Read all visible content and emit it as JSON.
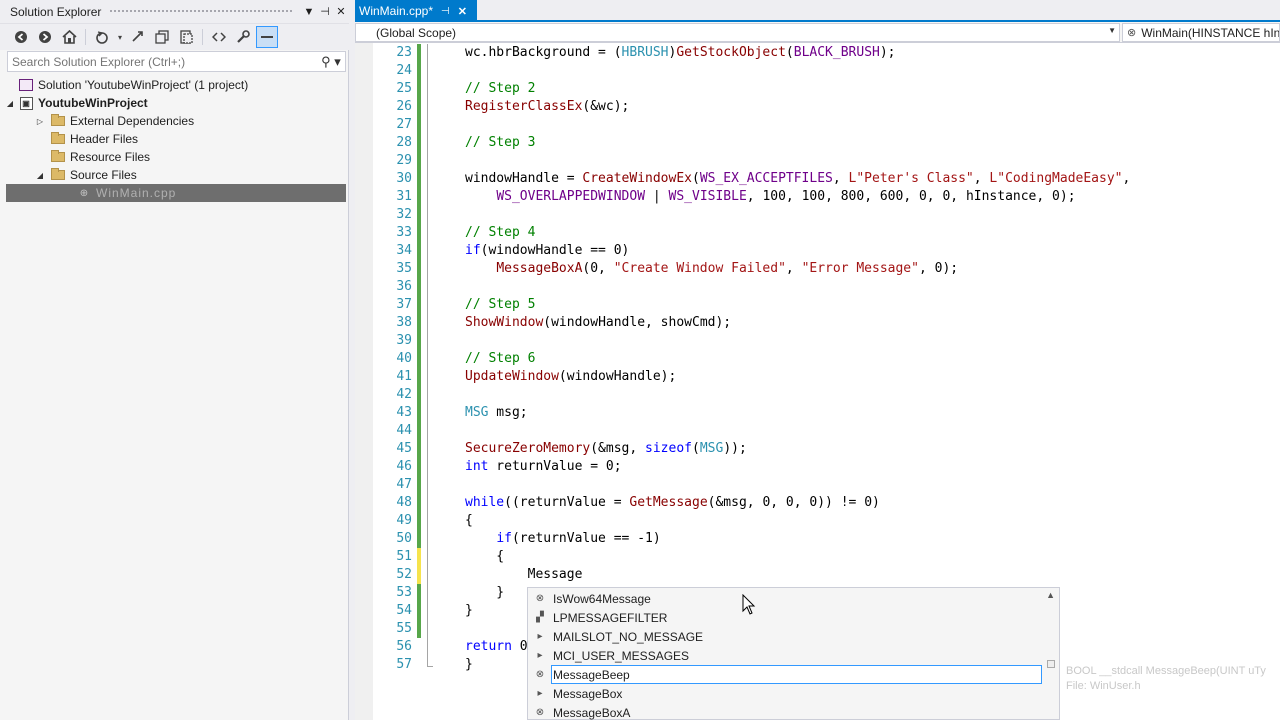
{
  "solution_explorer": {
    "title": "Solution Explorer",
    "title_buttons": [
      "▼",
      "📌",
      "✕"
    ],
    "search_placeholder": "Search Solution Explorer (Ctrl+;)",
    "tree": [
      {
        "label": "Solution 'YoutubeWinProject' (1 project)",
        "icon": "solution-icon",
        "level": 0
      },
      {
        "label": "YoutubeWinProject",
        "icon": "project-icon",
        "level": 0,
        "expanded": true
      },
      {
        "label": "External Dependencies",
        "icon": "external-deps-icon",
        "level": 1,
        "collapsed": true
      },
      {
        "label": "Header Files",
        "icon": "folder-icon",
        "level": 1
      },
      {
        "label": "Resource Files",
        "icon": "folder-icon",
        "level": 1
      },
      {
        "label": "Source Files",
        "icon": "folder-icon",
        "level": 1,
        "expanded": true
      },
      {
        "label": "WinMain.cpp",
        "icon": "cpp-file-icon",
        "level": 2,
        "selected": true
      }
    ]
  },
  "editor": {
    "tab_label": "WinMain.cpp*",
    "tab_pin": "⊣",
    "tab_close": "✕",
    "scope": "(Global Scope)",
    "function": "WinMain(HINSTANCE hInstance,",
    "current_line": "52",
    "lines": [
      {
        "n": "23",
        "code": "wc.hbrBackground = (HBRUSH)GetStockObject(BLACK_BRUSH);"
      },
      {
        "n": "24",
        "code": ""
      },
      {
        "n": "25",
        "code": "// Step 2"
      },
      {
        "n": "26",
        "code": "RegisterClassEx(&wc);"
      },
      {
        "n": "27",
        "code": ""
      },
      {
        "n": "28",
        "code": "// Step 3"
      },
      {
        "n": "29",
        "code": ""
      },
      {
        "n": "30",
        "code": "windowHandle = CreateWindowEx(WS_EX_ACCEPTFILES, L\"Peter's Class\", L\"CodingMadeEasy\","
      },
      {
        "n": "31",
        "code": "    WS_OVERLAPPEDWINDOW | WS_VISIBLE, 100, 100, 800, 600, 0, 0, hInstance, 0);"
      },
      {
        "n": "32",
        "code": ""
      },
      {
        "n": "33",
        "code": "// Step 4"
      },
      {
        "n": "34",
        "code": "if(windowHandle == 0)"
      },
      {
        "n": "35",
        "code": "    MessageBoxA(0, \"Create Window Failed\", \"Error Message\", 0);"
      },
      {
        "n": "36",
        "code": ""
      },
      {
        "n": "37",
        "code": "// Step 5"
      },
      {
        "n": "38",
        "code": "ShowWindow(windowHandle, showCmd);"
      },
      {
        "n": "39",
        "code": ""
      },
      {
        "n": "40",
        "code": "// Step 6"
      },
      {
        "n": "41",
        "code": "UpdateWindow(windowHandle);"
      },
      {
        "n": "42",
        "code": ""
      },
      {
        "n": "43",
        "code": "MSG msg;"
      },
      {
        "n": "44",
        "code": ""
      },
      {
        "n": "45",
        "code": "SecureZeroMemory(&msg, sizeof(MSG));"
      },
      {
        "n": "46",
        "code": "int returnValue = 0;"
      },
      {
        "n": "47",
        "code": ""
      },
      {
        "n": "48",
        "code": "while((returnValue = GetMessage(&msg, 0, 0, 0)) != 0)"
      },
      {
        "n": "49",
        "code": "{"
      },
      {
        "n": "50",
        "code": "    if(returnValue == -1)"
      },
      {
        "n": "51",
        "code": "    {"
      },
      {
        "n": "52",
        "code": "        Message"
      },
      {
        "n": "53",
        "code": "    }"
      },
      {
        "n": "54",
        "code": "}"
      },
      {
        "n": "55",
        "code": ""
      },
      {
        "n": "56",
        "code": "return 0"
      },
      {
        "n": "57",
        "code": "}"
      }
    ]
  },
  "intellisense": {
    "items": [
      {
        "label": "IsWow64Message",
        "icon": "function-icon"
      },
      {
        "label": "LPMESSAGEFILTER",
        "icon": "typedef-icon"
      },
      {
        "label": "MAILSLOT_NO_MESSAGE",
        "icon": "macro-icon"
      },
      {
        "label": "MCI_USER_MESSAGES",
        "icon": "macro-icon"
      },
      {
        "label": "MessageBeep",
        "icon": "function-icon",
        "selected": true
      },
      {
        "label": "MessageBox",
        "icon": "macro-icon"
      },
      {
        "label": "MessageBoxA",
        "icon": "function-icon"
      }
    ],
    "tooltip_line1": "BOOL __stdcall MessageBeep(UINT uTy",
    "tooltip_line2": "File: WinUser.h"
  },
  "colors": {
    "accent": "#007acc",
    "keyword": "#0000ff",
    "comment": "#008000",
    "string": "#a31515",
    "line_number": "#2b91af",
    "change_saved": "#57a64a",
    "change_unsaved": "#f6e34c"
  }
}
